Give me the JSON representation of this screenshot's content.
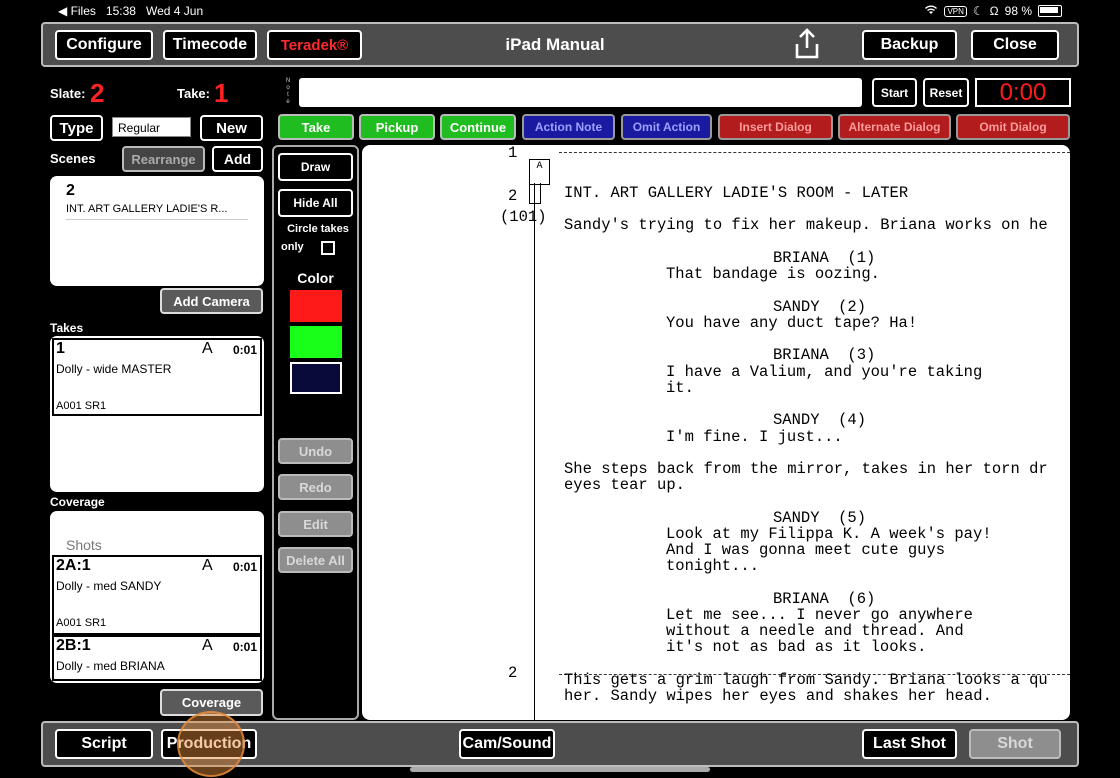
{
  "status_bar": {
    "back_app": "◀ Files",
    "time": "15:38",
    "date": "Wed 4 Jun",
    "vpn": "VPN",
    "battery": "98 %"
  },
  "top_bar": {
    "configure": "Configure",
    "timecode": "Timecode",
    "teradek": "Teradek®",
    "title": "iPad Manual",
    "backup": "Backup",
    "close": "Close"
  },
  "slate": {
    "label": "Slate:",
    "value": "2",
    "take_label": "Take:",
    "take_value": "1"
  },
  "note": {
    "label": "Note",
    "value": ""
  },
  "timer": {
    "start": "Start",
    "reset": "Reset",
    "value": "0:00"
  },
  "type_row": {
    "type": "Type",
    "field_value": "Regular",
    "new": "New"
  },
  "take_buttons": [
    "Take",
    "Pickup",
    "Continue",
    "Action Note",
    "Omit Action",
    "Insert Dialog",
    "Alternate Dialog",
    "Omit Dialog"
  ],
  "scenes": {
    "label": "Scenes",
    "rearrange": "Rearrange",
    "add": "Add",
    "item_num": "2",
    "item_title": "INT. ART GALLERY LADIE'S R...",
    "add_camera": "Add Camera"
  },
  "takes": {
    "label": "Takes",
    "items": [
      {
        "num": "1",
        "cam": "A",
        "dur": "0:01",
        "desc": "Dolly - wide MASTER",
        "reel": "A001  SR1"
      }
    ]
  },
  "coverage": {
    "label": "Coverage",
    "shots_label": "Shots",
    "items": [
      {
        "num": "2A:1",
        "cam": "A",
        "dur": "0:01",
        "desc": "Dolly - med SANDY",
        "reel": "A001  SR1"
      },
      {
        "num": "2B:1",
        "cam": "A",
        "dur": "0:01",
        "desc": "Dolly - med BRIANA",
        "reel": ""
      }
    ],
    "button": "Coverage"
  },
  "tools": {
    "draw": "Draw",
    "hide_all": "Hide All",
    "circle_takes": "Circle takes",
    "only": "only",
    "color_label": "Color",
    "colors": [
      "#ff1a1a",
      "#1aff1a",
      "#0a0a3a"
    ],
    "undo": "Undo",
    "redo": "Redo",
    "edit": "Edit",
    "delete_all": "Delete All"
  },
  "script": {
    "marker_1": "1",
    "marker_A": "A",
    "marker_2": "2",
    "marker_101": "(101)",
    "marker_2b": "2",
    "lines": [
      "INT. ART GALLERY LADIE'S ROOM - LATER",
      "Sandy's trying to fix her makeup. Briana works on he",
      "BRIANA  (1)",
      "That bandage is oozing.",
      "SANDY  (2)",
      "You have any duct tape? Ha!",
      "BRIANA  (3)",
      "I have a Valium, and you're taking",
      "it.",
      "SANDY  (4)",
      "I'm fine. I just...",
      "She steps back from the mirror, takes in her torn dr",
      "eyes tear up.",
      "SANDY  (5)",
      "Look at my Filippa K. A week's pay!",
      "And I was gonna meet cute guys",
      "tonight...",
      "BRIANA  (6)",
      "Let me see... I never go anywhere",
      "without a needle and thread. And",
      "it's not as bad as it looks.",
      "This gets a grim laugh from Sandy. Briana looks a qu",
      "her. Sandy wipes her eyes and shakes her head."
    ]
  },
  "bottom_bar": {
    "script": "Script",
    "production": "Production",
    "cam_sound": "Cam/Sound",
    "last_shot": "Last Shot",
    "shot": "Shot"
  }
}
